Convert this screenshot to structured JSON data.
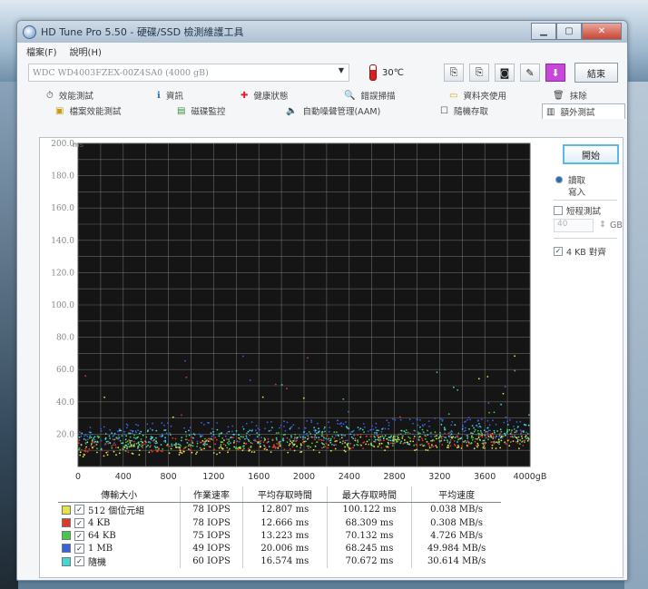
{
  "window": {
    "title": "HD Tune Pro 5.50 - 硬碟/SSD 檢測維護工具"
  },
  "menu": [
    "檔案(F)",
    "說明(H)"
  ],
  "toolbar": {
    "drive": "WDC WD4003FZEX-00Z4SA0 (4000 gB)",
    "temperature": "30℃",
    "exit_label": "結束"
  },
  "tabs_row1": [
    "效能測試",
    "資訊",
    "健康狀態",
    "錯誤掃描",
    "資料夾使用",
    "抹除"
  ],
  "tabs_row2": [
    "檔案效能測試",
    "磁碟監控",
    "自動噪聲管理(AAM)",
    "隨機存取",
    "額外測試"
  ],
  "tab_icons": {
    "row1": [
      "benchmark-icon",
      "info-icon",
      "health-icon",
      "error-scan-icon",
      "folder-icon",
      "trash-icon"
    ],
    "row2": [
      "file-benchmark-icon",
      "disk-monitor-icon",
      "speaker-icon",
      "random-access-icon",
      "extra-tests-icon"
    ]
  },
  "sidebar": {
    "start_label": "開始",
    "read_label": "讀取",
    "write_label": "寫入",
    "short_test_label": "短程測試",
    "size_value": "40",
    "size_unit": "GB",
    "align_label": "4 KB 對齊",
    "mode": "read",
    "short_test_checked": false,
    "align_checked": true
  },
  "chart_data": {
    "type": "scatter",
    "y_ticks": [
      "200.0",
      "180.0",
      "160.0",
      "140.0",
      "120.0",
      "100.0",
      "80.0",
      "60.0",
      "40.0",
      "20.0"
    ],
    "x_ticks": [
      "0",
      "400",
      "800",
      "1200",
      "1600",
      "2000",
      "2400",
      "2800",
      "3200",
      "3600",
      "4000gB"
    ],
    "xlim": [
      0,
      4000
    ],
    "ylim": [
      0,
      200
    ],
    "ylabel": "ms",
    "grid": true,
    "series": [
      {
        "name": "512 個位元組",
        "color": "#e8e24a",
        "band": [
          6,
          16
        ]
      },
      {
        "name": "4 KB",
        "color": "#e03a2a",
        "band": [
          8,
          17
        ]
      },
      {
        "name": "64 KB",
        "color": "#47c84a",
        "band": [
          9,
          19
        ]
      },
      {
        "name": "1 MB",
        "color": "#3a5fe0",
        "band": [
          13,
          26
        ]
      },
      {
        "name": "隨機",
        "color": "#44d7d7",
        "band": [
          10,
          22
        ]
      }
    ]
  },
  "results": {
    "headers": [
      "傳輸大小",
      "作業速率",
      "平均存取時間",
      "最大存取時間",
      "平均速度"
    ],
    "rows": [
      {
        "label": "512 個位元組",
        "rate": "78 IOPS",
        "avg": "12.807 ms",
        "max": "100.122 ms",
        "speed": "0.038 MB/s",
        "color": "#e8e24a"
      },
      {
        "label": "4 KB",
        "rate": "78 IOPS",
        "avg": "12.666 ms",
        "max": "68.309 ms",
        "speed": "0.308 MB/s",
        "color": "#e03a2a"
      },
      {
        "label": "64 KB",
        "rate": "75 IOPS",
        "avg": "13.223 ms",
        "max": "70.132 ms",
        "speed": "4.726 MB/s",
        "color": "#47c84a"
      },
      {
        "label": "1 MB",
        "rate": "49 IOPS",
        "avg": "20.006 ms",
        "max": "68.245 ms",
        "speed": "49.984 MB/s",
        "color": "#3a5fe0"
      },
      {
        "label": "隨機",
        "rate": "60 IOPS",
        "avg": "16.574 ms",
        "max": "70.672 ms",
        "speed": "30.614 MB/s",
        "color": "#44d7d7"
      }
    ]
  }
}
